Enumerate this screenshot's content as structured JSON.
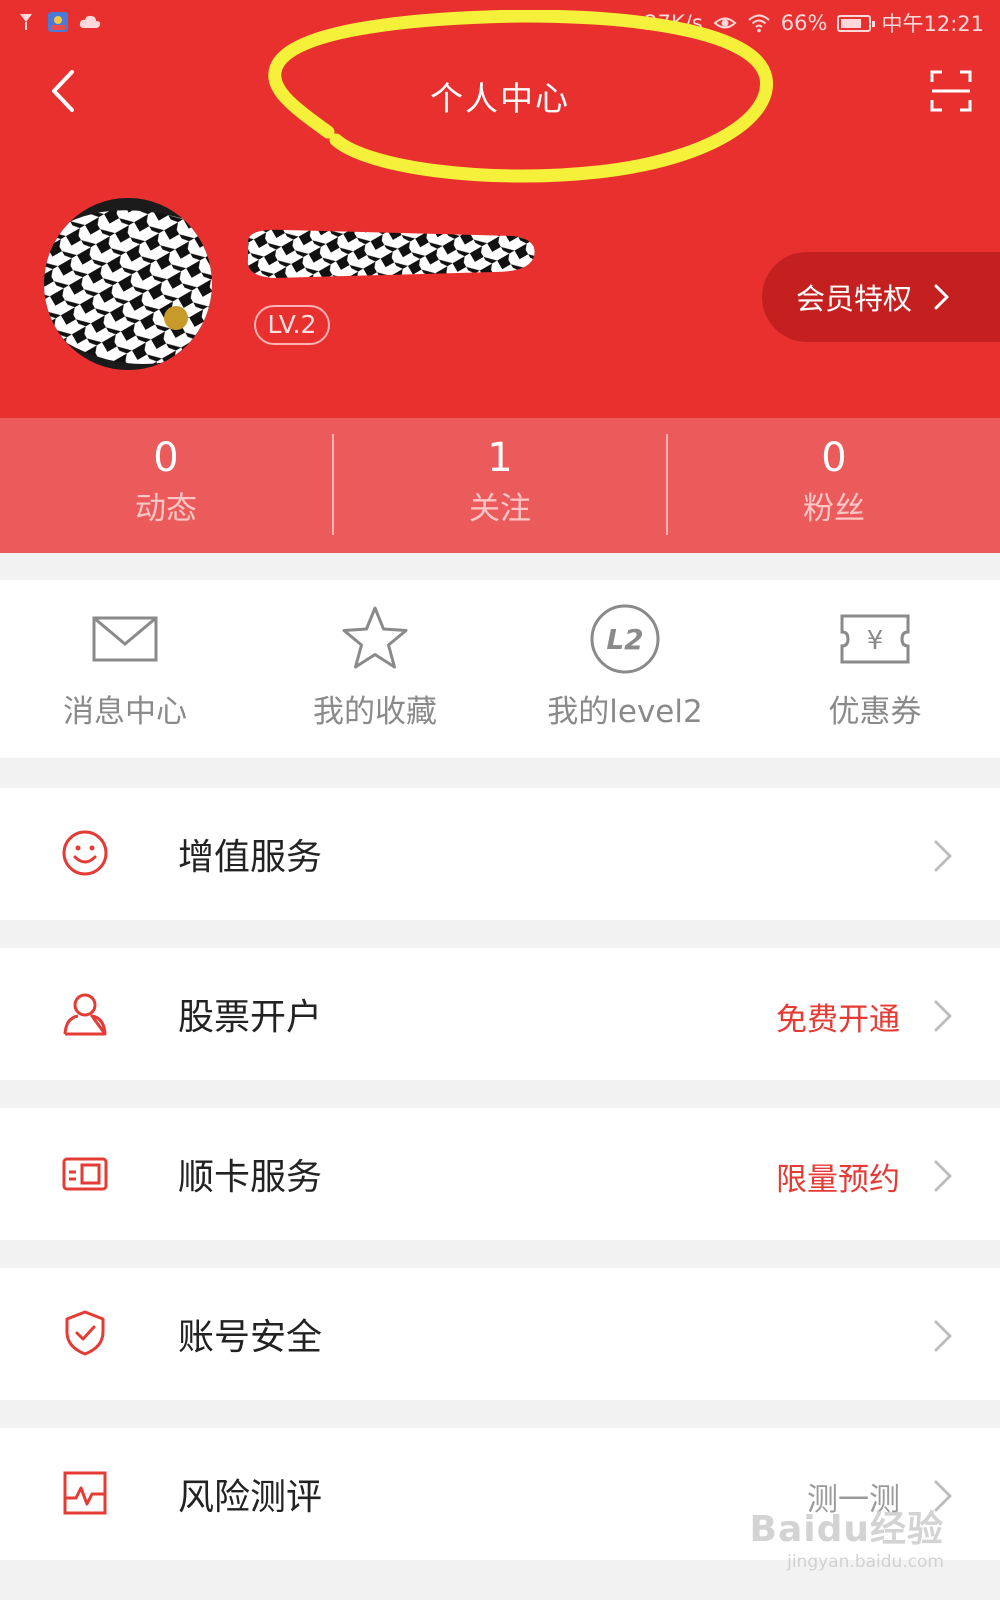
{
  "status_bar": {
    "network_speed": "27K/s",
    "battery": "66%",
    "time": "中午12:21"
  },
  "header": {
    "title": "个人中心",
    "level": "LV.2",
    "vip_label": "会员特权"
  },
  "stats": [
    {
      "value": "0",
      "label": "动态"
    },
    {
      "value": "1",
      "label": "关注"
    },
    {
      "value": "0",
      "label": "粉丝"
    }
  ],
  "quick_actions": [
    {
      "label": "消息中心",
      "icon": "envelope-icon"
    },
    {
      "label": "我的收藏",
      "icon": "star-icon"
    },
    {
      "label": "我的level2",
      "icon": "level2-icon",
      "icon_text": "L2"
    },
    {
      "label": "优惠券",
      "icon": "coupon-icon",
      "icon_text": "¥"
    }
  ],
  "menu": [
    {
      "label": "增值服务",
      "note": "",
      "icon": "smiley-icon"
    },
    {
      "label": "股票开户",
      "note": "免费开通",
      "icon": "person-icon"
    },
    {
      "label": "顺卡服务",
      "note": "限量预约",
      "icon": "card-icon"
    },
    {
      "label": "账号安全",
      "note": "",
      "icon": "shield-icon"
    },
    {
      "label": "风险测评",
      "note": "测一测",
      "icon": "pulse-icon"
    }
  ],
  "watermark": {
    "brand": "Baidu经验",
    "url": "jingyan.baidu.com"
  },
  "colors": {
    "header_red": "#e8302f",
    "stats_red": "#ec5b5b",
    "vip_dark_red": "#c42020",
    "accent_red": "#e53b35",
    "highlight_yellow": "#f5f03a"
  }
}
